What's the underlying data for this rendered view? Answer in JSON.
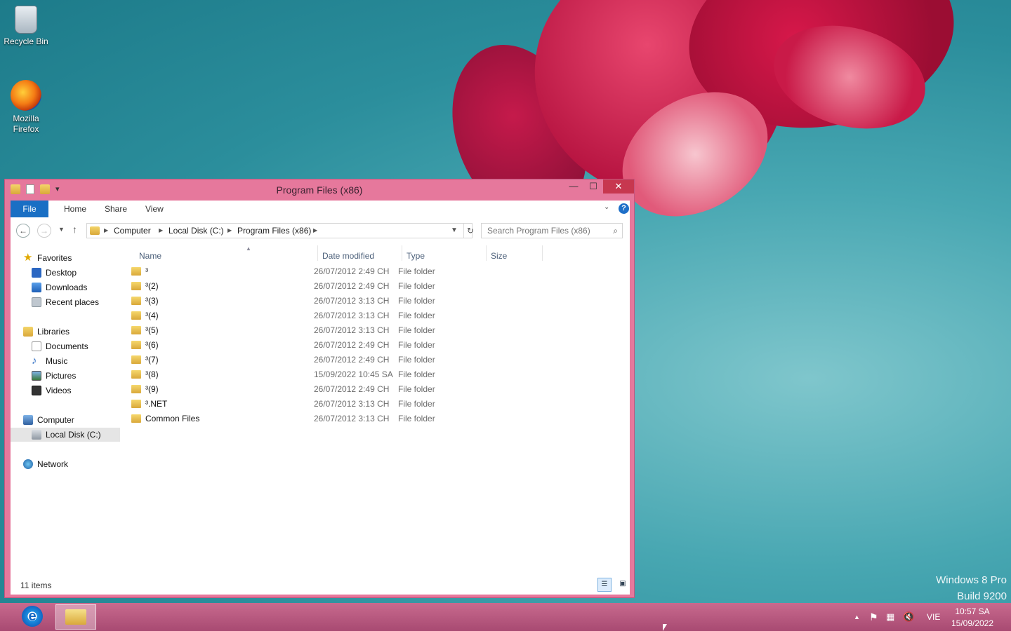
{
  "desktop": {
    "icons": [
      {
        "label": "Recycle Bin"
      },
      {
        "label": "Mozilla Firefox"
      }
    ],
    "watermark": {
      "line1": "Windows 8 Pro",
      "line2": "Build 9200"
    }
  },
  "window": {
    "title": "Program Files (x86)",
    "controls": {
      "minimize": "—",
      "maximize": "☐",
      "close": "✕"
    },
    "ribbon": {
      "tabs": {
        "file": "File",
        "home": "Home",
        "share": "Share",
        "view": "View"
      },
      "help": "?"
    },
    "address": {
      "segments": [
        "Computer",
        "Local Disk (C:)",
        "Program Files (x86)"
      ]
    },
    "search": {
      "placeholder": "Search Program Files (x86)"
    },
    "nav_tree": {
      "favorites": "Favorites",
      "desktop": "Desktop",
      "downloads": "Downloads",
      "recent_places": "Recent places",
      "libraries": "Libraries",
      "documents": "Documents",
      "music": "Music",
      "pictures": "Pictures",
      "videos": "Videos",
      "computer": "Computer",
      "local_disk": "Local Disk (C:)",
      "network": "Network"
    },
    "columns": {
      "name": "Name",
      "date": "Date modified",
      "type": "Type",
      "size": "Size"
    },
    "files": [
      {
        "name": "³",
        "date": "26/07/2012 2:49 CH",
        "type": "File folder"
      },
      {
        "name": "³(2)",
        "date": "26/07/2012 2:49 CH",
        "type": "File folder"
      },
      {
        "name": "³(3)",
        "date": "26/07/2012 3:13 CH",
        "type": "File folder"
      },
      {
        "name": "³(4)",
        "date": "26/07/2012 3:13 CH",
        "type": "File folder"
      },
      {
        "name": "³(5)",
        "date": "26/07/2012 3:13 CH",
        "type": "File folder"
      },
      {
        "name": "³(6)",
        "date": "26/07/2012 2:49 CH",
        "type": "File folder"
      },
      {
        "name": "³(7)",
        "date": "26/07/2012 2:49 CH",
        "type": "File folder"
      },
      {
        "name": "³(8)",
        "date": "15/09/2022 10:45 SA",
        "type": "File folder"
      },
      {
        "name": "³(9)",
        "date": "26/07/2012 2:49 CH",
        "type": "File folder"
      },
      {
        "name": "³.NET",
        "date": "26/07/2012 3:13 CH",
        "type": "File folder"
      },
      {
        "name": "Common Files",
        "date": "26/07/2012 3:13 CH",
        "type": "File folder"
      }
    ],
    "status": {
      "count": "11 items"
    }
  },
  "taskbar": {
    "language": "VIE",
    "time": "10:57 SA",
    "date": "15/09/2022"
  }
}
